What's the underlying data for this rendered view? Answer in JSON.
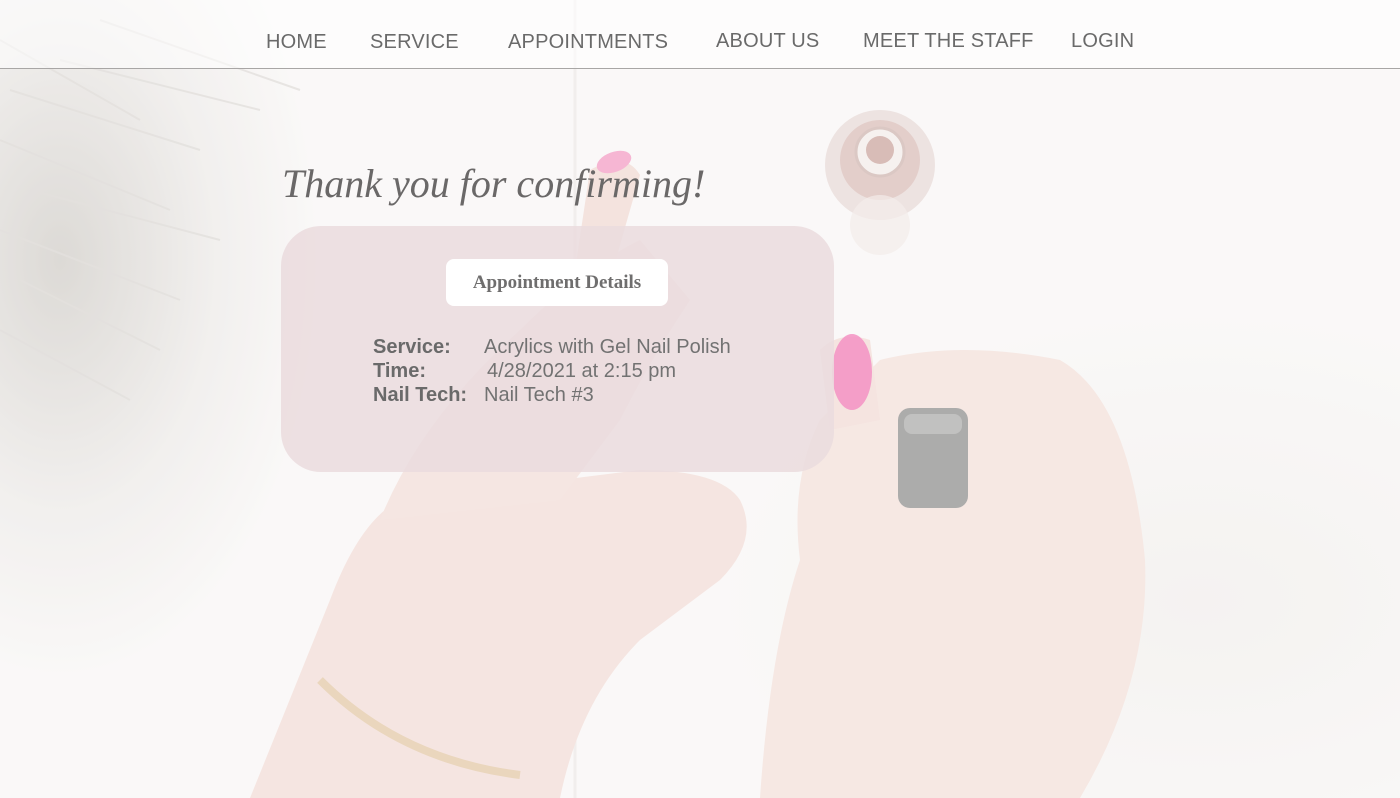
{
  "nav": {
    "items": [
      {
        "label": "HOME"
      },
      {
        "label": "SERVICE"
      },
      {
        "label": "APPOINTMENTS"
      },
      {
        "label": "ABOUT US"
      },
      {
        "label": "MEET THE STAFF"
      },
      {
        "label": "LOGIN"
      }
    ]
  },
  "confirmation": {
    "title": "Thank you for confirming!",
    "details_button": "Appointment Details",
    "rows": [
      {
        "label": "Service:",
        "value": "Acrylics with Gel Nail Polish"
      },
      {
        "label": "Time:",
        "value": "4/28/2021 at 2:15 pm"
      },
      {
        "label": "Nail Tech:",
        "value": "Nail Tech #3"
      }
    ]
  },
  "colors": {
    "text": "#6a6a6a",
    "card_background": "#ebdcde",
    "nail_polish": "#e94f9a",
    "nav_border": "#a8a6a5"
  }
}
